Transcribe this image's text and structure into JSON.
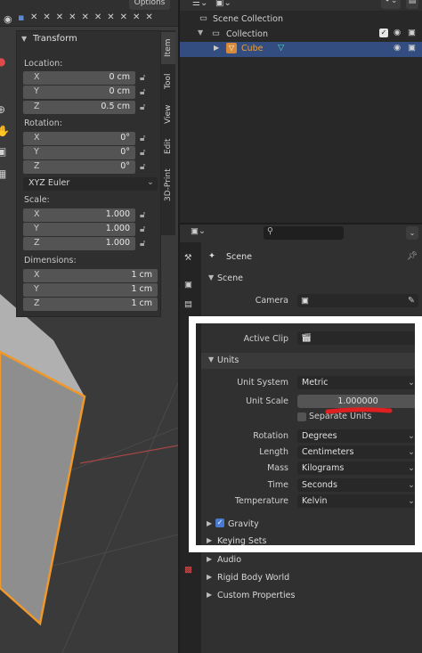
{
  "viewport": {
    "options_label": "Options",
    "transform_title": "Transform",
    "location_label": "Location:",
    "location": [
      {
        "axis": "X",
        "value": "0 cm"
      },
      {
        "axis": "Y",
        "value": "0 cm"
      },
      {
        "axis": "Z",
        "value": "0.5 cm"
      }
    ],
    "rotation_label": "Rotation:",
    "rotation": [
      {
        "axis": "X",
        "value": "0°"
      },
      {
        "axis": "Y",
        "value": "0°"
      },
      {
        "axis": "Z",
        "value": "0°"
      }
    ],
    "rotation_mode": "XYZ Euler",
    "scale_label": "Scale:",
    "scale": [
      {
        "axis": "X",
        "value": "1.000"
      },
      {
        "axis": "Y",
        "value": "1.000"
      },
      {
        "axis": "Z",
        "value": "1.000"
      }
    ],
    "dimensions_label": "Dimensions:",
    "dimensions": [
      {
        "axis": "X",
        "value": "1 cm"
      },
      {
        "axis": "Y",
        "value": "1 cm"
      },
      {
        "axis": "Z",
        "value": "1 cm"
      }
    ],
    "tabs": [
      "Item",
      "Tool",
      "View",
      "Edit",
      "3D-Print"
    ]
  },
  "outliner": {
    "scene_collection": "Scene Collection",
    "collection": "Collection",
    "cube": "Cube"
  },
  "properties": {
    "scene_header": "Scene",
    "scene_section": "Scene",
    "camera_label": "Camera",
    "active_clip_label": "Active Clip",
    "units_section": "Units",
    "unit_system_label": "Unit System",
    "unit_system": "Metric",
    "unit_scale_label": "Unit Scale",
    "unit_scale": "1.000000",
    "separate_units": "Separate Units",
    "rotation_label": "Rotation",
    "rotation": "Degrees",
    "length_label": "Length",
    "length": "Centimeters",
    "mass_label": "Mass",
    "mass": "Kilograms",
    "time_label": "Time",
    "time": "Seconds",
    "temperature_label": "Temperature",
    "temperature": "Kelvin",
    "gravity": "Gravity",
    "keying_sets": "Keying Sets",
    "audio": "Audio",
    "rigid_body_world": "Rigid Body World",
    "custom_properties": "Custom Properties"
  },
  "colors": {
    "accent_orange": "#e8a03a",
    "selection_blue": "#334d80",
    "annotation_red": "#e02020"
  }
}
